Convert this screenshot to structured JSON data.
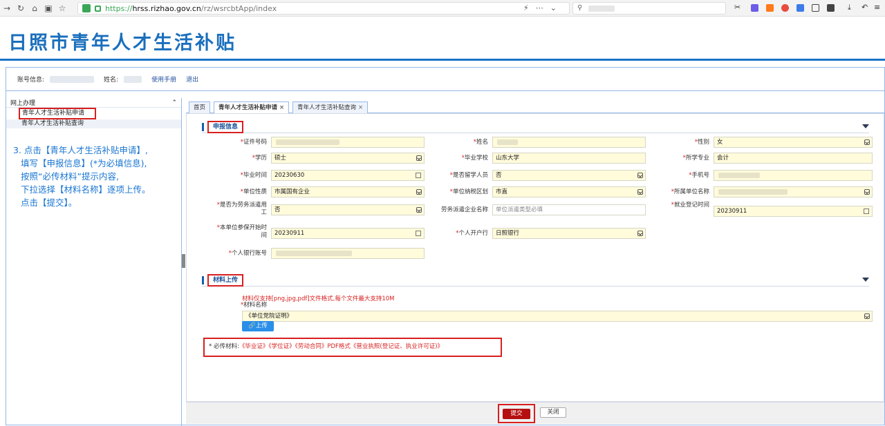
{
  "browser": {
    "url_https": "https://",
    "url_host": "hrss.rizhao.gov.cn",
    "url_path": "/rz/wsrcbtApp/index",
    "search_icon": "search-icon"
  },
  "banner": {
    "title": "日照市青年人才生活补贴"
  },
  "topbar": {
    "account_label": "账号信息:",
    "name_label": "姓名:",
    "manual_link": "使用手册",
    "logout_link": "退出"
  },
  "sidebar": {
    "header": "网上办理",
    "items": [
      {
        "label": "青年人才生活补贴申请"
      },
      {
        "label": "青年人才生活补贴查询"
      }
    ],
    "guide_lines": [
      "3. 点击【青年人才生活补贴申请】,",
      "   填写【申报信息】(*为必填信息),",
      "   按照“必传材料”提示内容,",
      "   下拉选择【材料名称】逐项上传。",
      "   点击【提交】。"
    ]
  },
  "tabs": [
    {
      "label": "首页",
      "closable": false
    },
    {
      "label": "青年人才生活补贴申请",
      "closable": true
    },
    {
      "label": "青年人才生活补贴查询",
      "closable": true
    }
  ],
  "sections": {
    "apply_info": "申报信息",
    "upload": "材料上传"
  },
  "form": {
    "id_number": {
      "label": "证件号码",
      "value": ""
    },
    "name": {
      "label": "姓名",
      "value": ""
    },
    "gender": {
      "label": "性别",
      "value": "女"
    },
    "education": {
      "label": "学历",
      "value": "硕士"
    },
    "school": {
      "label": "毕业学校",
      "value": "山东大学"
    },
    "major": {
      "label": "所学专业",
      "value": "会计"
    },
    "grad_time": {
      "label": "毕业时间",
      "value": "20230630"
    },
    "overseas": {
      "label": "是否留学人员",
      "value": "否"
    },
    "phone": {
      "label": "手机号",
      "value": ""
    },
    "unit_type": {
      "label": "单位性质",
      "value": "市属国有企业"
    },
    "tax_district": {
      "label": "单位纳税区划",
      "value": "市直"
    },
    "unit_name": {
      "label": "所属单位名称",
      "value": ""
    },
    "dispatch_l1": "是否为劳务派遣用",
    "dispatch_l2": "工",
    "dispatch_value": "否",
    "dispatch_company_label": "劳务派遣企业名称",
    "dispatch_company_placeholder": "单位派遣类型必填",
    "employ_reg_label": "就业登记时间",
    "employ_reg_value": "20230911",
    "insurance_l1": "本单位参保开始时",
    "insurance_l2": "间",
    "insurance_value": "20230911",
    "bank_label": "个人开户行",
    "bank_value": "日照银行",
    "account_label": "个人银行账号",
    "account_value": ""
  },
  "upload": {
    "format_notice": "材料仅支持[png,jpg,pdf]文件格式,每个文件最大支持10M",
    "material_label": "材料名称",
    "material_value": "《单位党院证明》",
    "upload_button": "上传",
    "required_prefix": "* 必传材料:",
    "required_list": "《毕业证》《学位证》《劳动合同》PDF格式《营业执照(登记证、执业许可证)》"
  },
  "footer": {
    "submit": "提交",
    "close": "关闭"
  }
}
